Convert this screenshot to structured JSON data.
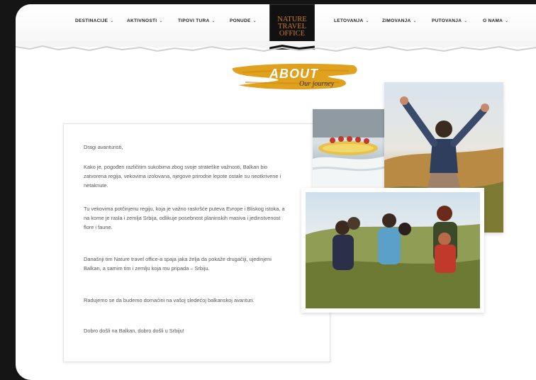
{
  "nav": {
    "left": [
      {
        "label": "DESTINACIJE"
      },
      {
        "label": "AKTIVNOSTI"
      },
      {
        "label": "TIPOVI TURA"
      },
      {
        "label": "PONUDE"
      }
    ],
    "right": [
      {
        "label": "LETOVANJA"
      },
      {
        "label": "ZIMOVANJA"
      },
      {
        "label": "PUTOVANJA"
      },
      {
        "label": "O NAMA"
      }
    ],
    "chevron": "⌄"
  },
  "logo": {
    "line1": "NATURE",
    "line2": "TRAVEL",
    "line3": "OFFICE"
  },
  "about": {
    "title": "ABOUT",
    "subtitle": "Our journey",
    "brush_color": "#e0a21e"
  },
  "body": {
    "greeting": "Dragi avanturisti,",
    "p1": "Kako je, pogođen različitim sukobima zbog svoje strateške važnosti, Balkan bio zatvorena regija, vekovima izolovana, njegove prirodne lepote ostale su neotkrivene i netaknute.",
    "p2": "Tu vekovima potčinjenu regiju, koja je važno raskršće puteva Evrope i Bliskog istoka, a na korne je rasla i zemlja Srbija, odlikuje posebnost planinskih masiva i jedinstvenost flore i faune.",
    "p3": "Današnji tim Nature travel office-a spaja jaka želja da pokaže drugačiji, ujedinjeni Balkan, a samim tim i zemlju koja mu pripada – Srbiju.",
    "p4": "Radujemo se da budemo domaćini na vašoj sledećoj balkanskoj avanturi.",
    "closing": "Dobro došli na Balkan, dobro došli u Srbiju!"
  }
}
